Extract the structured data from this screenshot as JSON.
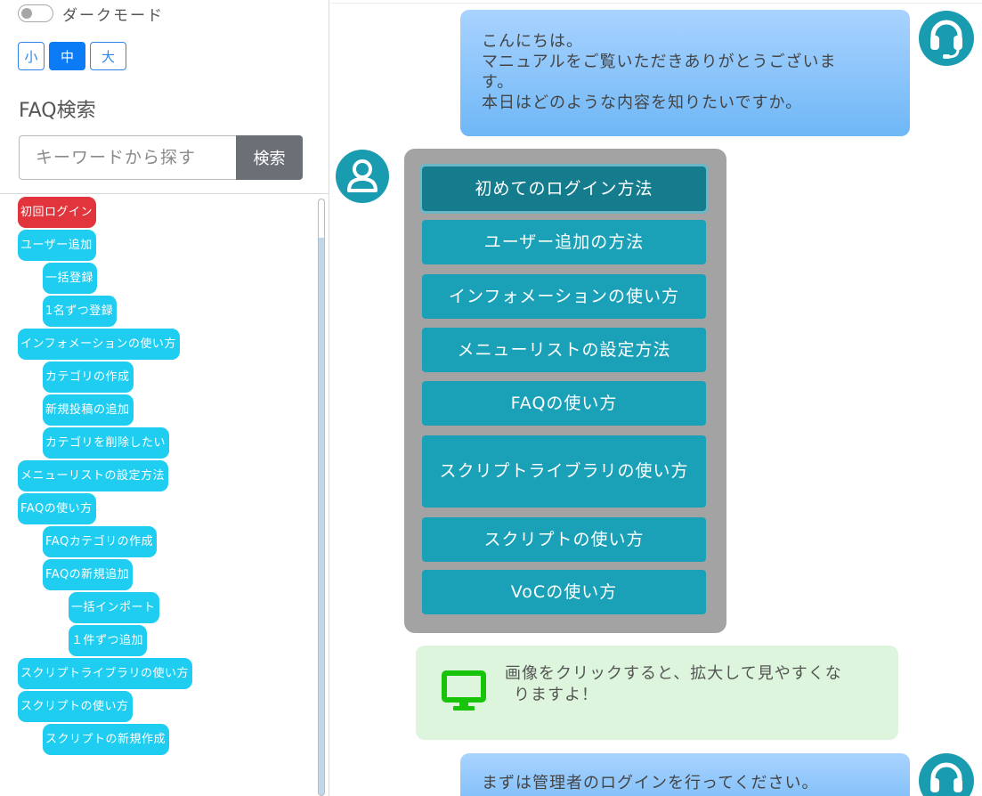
{
  "sidebar": {
    "dark_mode_label": "ダークモード",
    "font_sizes": [
      "小",
      "中",
      "大"
    ],
    "faq_title": "FAQ検索",
    "search_placeholder": "キーワードから探す",
    "search_button": "検索",
    "tree": [
      {
        "label": "初回ログイン",
        "level": 0,
        "highlight": true
      },
      {
        "label": "ユーザー追加",
        "level": 0
      },
      {
        "label": "一括登録",
        "level": 1
      },
      {
        "label": "1名ずつ登録",
        "level": 1
      },
      {
        "label": "インフォメーションの使い方",
        "level": 0
      },
      {
        "label": "カテゴリの作成",
        "level": 1
      },
      {
        "label": "新規投稿の追加",
        "level": 1
      },
      {
        "label": "カテゴリを削除したい",
        "level": 1
      },
      {
        "label": "メニューリストの設定方法",
        "level": 0
      },
      {
        "label": "FAQの使い方",
        "level": 0
      },
      {
        "label": "FAQカテゴリの作成",
        "level": 1
      },
      {
        "label": "FAQの新規追加",
        "level": 1
      },
      {
        "label": "一括インポート",
        "level": 2
      },
      {
        "label": "１件ずつ追加",
        "level": 2
      },
      {
        "label": "スクリプトライブラリの使い方",
        "level": 0
      },
      {
        "label": "スクリプトの使い方",
        "level": 0
      },
      {
        "label": "スクリプトの新規作成",
        "level": 1
      }
    ]
  },
  "chat": {
    "greeting_lines": [
      "こんにちは。",
      "マニュアルをご覧いただきありがとうございま",
      "す。",
      "本日はどのような内容を知りたいですか。"
    ],
    "menu_options": [
      "初めてのログイン方法",
      "ユーザー追加の方法",
      "インフォメーションの使い方",
      "メニューリストの設定方法",
      "FAQの使い方",
      "スクリプトライブラリの使い方",
      "スクリプトの使い方",
      "VoCの使い方"
    ],
    "tip_lines": [
      "画像をクリックすると、拡大して見やすくな",
      "りますよ！"
    ],
    "reply": "まずは管理者のログインを行ってください。"
  },
  "colors": {
    "node": "#1fcdf1",
    "node_active": "#e1343d",
    "menu_button": "#1aa1b8",
    "avatar": "#1a9cb0",
    "tip_background": "#ddf5dc",
    "monitor_icon": "#18c40a"
  }
}
